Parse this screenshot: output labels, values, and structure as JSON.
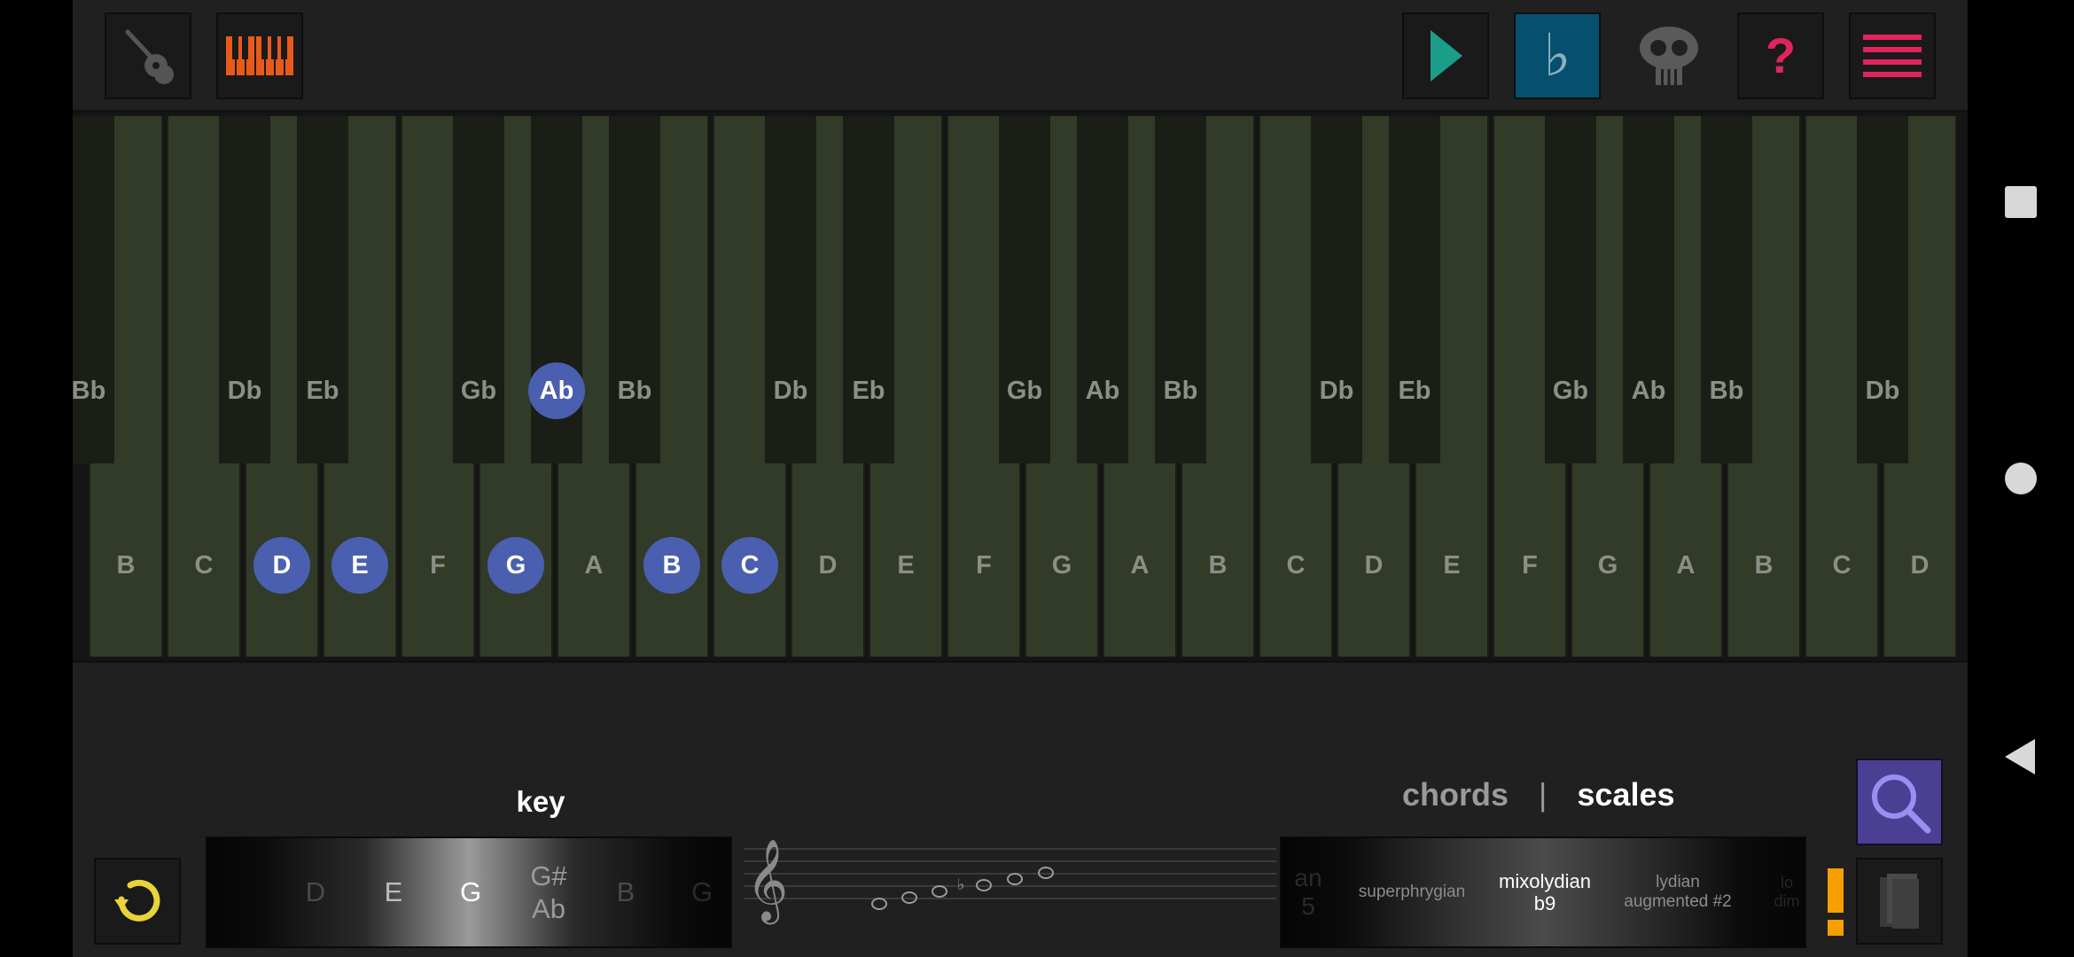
{
  "toolbar": {
    "guitar": "guitar-icon",
    "piano": "piano-icon",
    "play": "play-icon",
    "accidental": "♭",
    "skull": "skull-icon",
    "help": "?",
    "menu": "menu-icon"
  },
  "keyboard": {
    "white_keys": [
      "B",
      "C",
      "D",
      "E",
      "F",
      "G",
      "A",
      "B",
      "C",
      "D",
      "E",
      "F",
      "G",
      "A",
      "B",
      "C",
      "D",
      "E",
      "F",
      "G",
      "A",
      "B",
      "C",
      "D"
    ],
    "black_keys": [
      "Bb",
      "Db",
      "Eb",
      "Gb",
      "Ab",
      "Bb",
      "Db",
      "Eb",
      "Gb",
      "Ab",
      "Bb",
      "Db",
      "Eb",
      "Gb",
      "Ab",
      "Bb",
      "Db"
    ],
    "highlighted_white": [
      2,
      3,
      5,
      7,
      8
    ],
    "highlighted_black": [
      4
    ]
  },
  "key_picker": {
    "label": "key",
    "items": [
      "D",
      "E",
      "G",
      "G#",
      "Ab",
      "B",
      "G"
    ]
  },
  "tabs": {
    "chords": "chords",
    "separator": "|",
    "scales": "scales"
  },
  "scale_picker": {
    "items": [
      {
        "line1": "an",
        "line2": "5"
      },
      {
        "line1": "superphrygian",
        "line2": ""
      },
      {
        "line1": "mixolydian",
        "line2": "b9"
      },
      {
        "line1": "lydian",
        "line2": "augmented #2"
      },
      {
        "line1": "lo",
        "line2": "dim"
      }
    ]
  },
  "staff_flat": "♭",
  "warning": "!",
  "colors": {
    "highlight": "#4a5fb0",
    "accent_pink": "#e0245e",
    "play_green": "#1a9e8a",
    "undo_yellow": "#e8d43a",
    "search_purple": "#4b3f93",
    "warn_orange": "#f5a000"
  }
}
